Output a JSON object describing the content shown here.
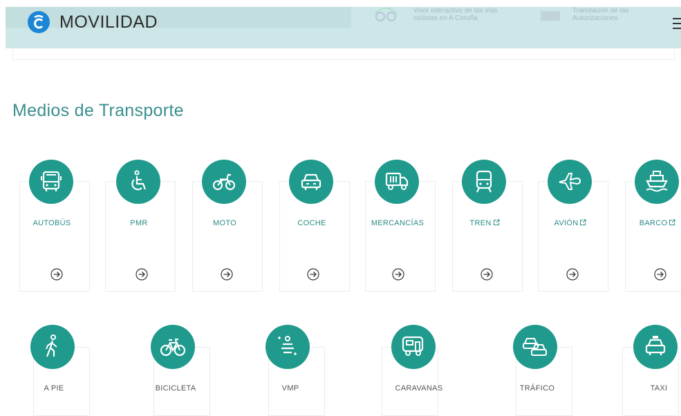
{
  "header": {
    "brand": "MOVILIDAD",
    "promo1": "Visor interactivo de las vías ciclistas en A Coruña",
    "promo2": "Tramitación de las Autorizaciones"
  },
  "section": {
    "title": "Medios de Transporte"
  },
  "colors": {
    "teal": "#1f9a8d",
    "header_bg": "#cde6e7",
    "brand_blue": "#1b86d6"
  },
  "row1": [
    {
      "label": "AUTOBÚS",
      "icon": "bus-icon"
    },
    {
      "label": "PMR",
      "icon": "wheelchair-icon"
    },
    {
      "label": "MOTO",
      "icon": "motorcycle-icon"
    },
    {
      "label": "COCHE",
      "icon": "car-icon"
    },
    {
      "label": "MERCANCÍAS",
      "icon": "truck-icon"
    },
    {
      "label": "TREN",
      "icon": "train-icon",
      "external": true
    },
    {
      "label": "AVIÓN",
      "icon": "plane-icon",
      "external": true
    },
    {
      "label": "BARCO",
      "icon": "ship-icon",
      "external": true
    }
  ],
  "row2": [
    {
      "label": "A PIE",
      "icon": "walking-icon"
    },
    {
      "label": "BICICLETA",
      "icon": "bicycle-icon"
    },
    {
      "label": "VMP",
      "icon": "scooter-icon"
    },
    {
      "label": "CARAVANAS",
      "icon": "caravan-icon"
    },
    {
      "label": "TRÁFICO",
      "icon": "traffic-icon"
    },
    {
      "label": "TAXI",
      "icon": "taxi-icon"
    }
  ]
}
